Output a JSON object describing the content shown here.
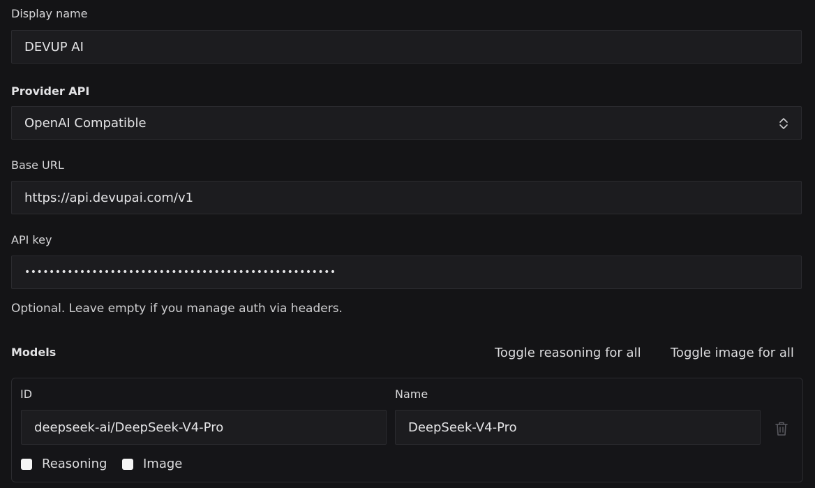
{
  "display_name": {
    "label": "Display name",
    "value": "DEVUP AI"
  },
  "provider_api": {
    "label": "Provider API",
    "value": "OpenAI Compatible",
    "icon": "chevron-up-down-icon"
  },
  "base_url": {
    "label": "Base URL",
    "value": "https://api.devupai.com/v1"
  },
  "api_key": {
    "label": "API key",
    "value": "•••••••••••••••••••••••••••••••••••••••••••••••••••",
    "help": "Optional. Leave empty if you manage auth via headers."
  },
  "models": {
    "title": "Models",
    "toggle_reasoning_label": "Toggle reasoning for all",
    "toggle_image_label": "Toggle image for all",
    "items": [
      {
        "id_label": "ID",
        "name_label": "Name",
        "id": "deepseek-ai/DeepSeek-V4-Pro",
        "name": "DeepSeek-V4-Pro",
        "reasoning_label": "Reasoning",
        "reasoning_checked": false,
        "image_label": "Image",
        "image_checked": false,
        "delete_icon": "trash-icon"
      }
    ]
  }
}
